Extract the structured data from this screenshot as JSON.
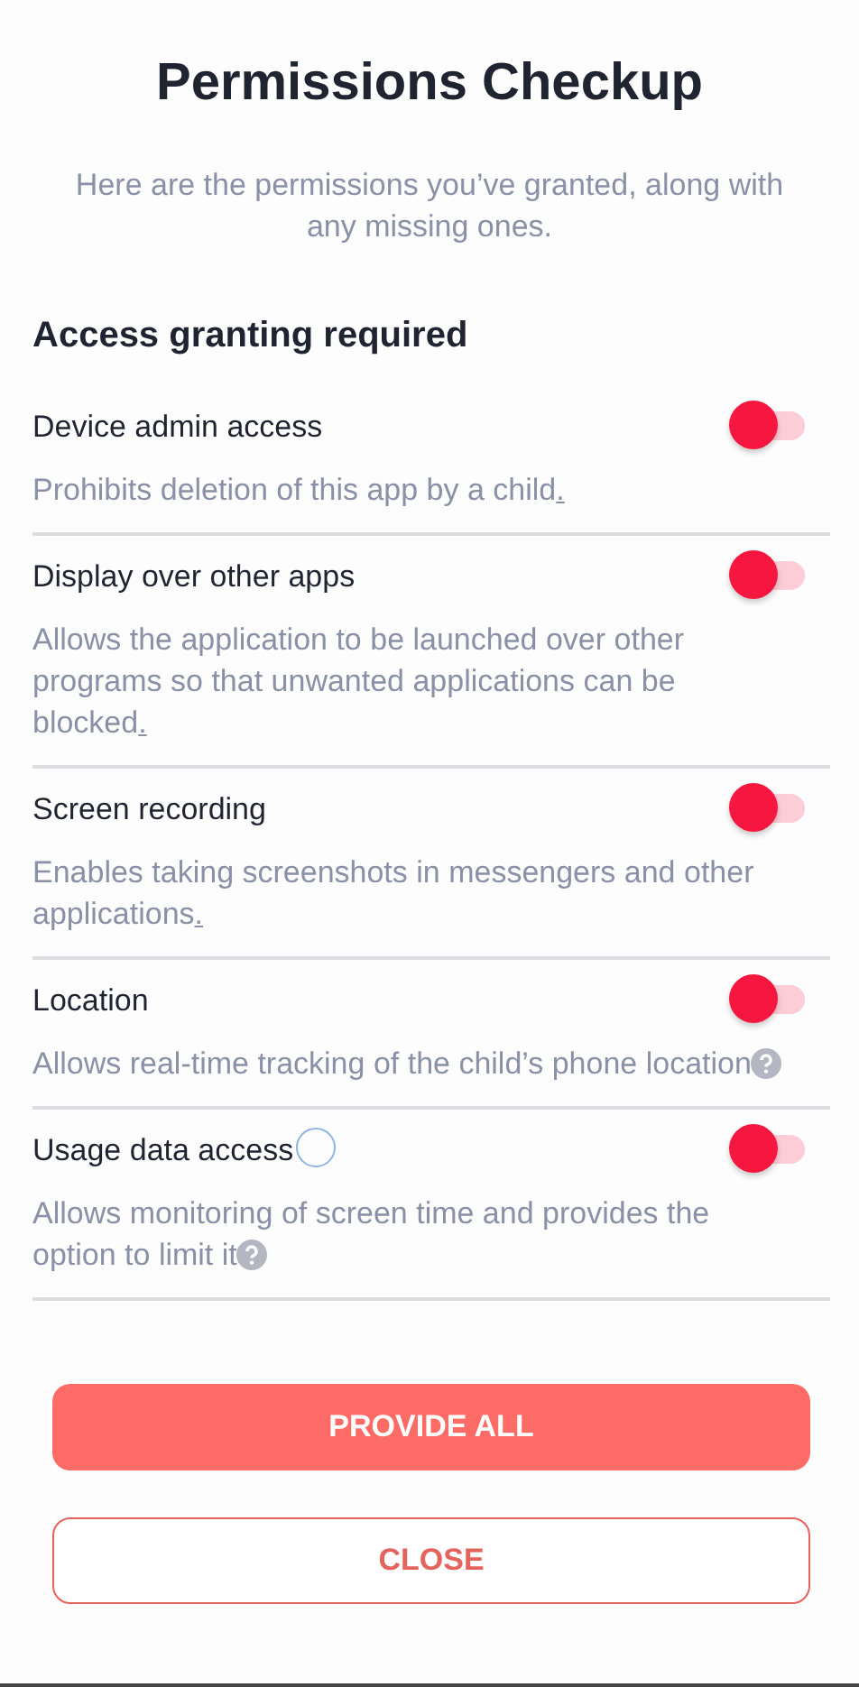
{
  "title": "Permissions Checkup",
  "subtitle": "Here are the permissions you’ve granted, along with any missing ones.",
  "section_title": "Access granting required",
  "permissions": [
    {
      "name": "Device admin access",
      "on": false,
      "description": "Prohibits deletion of this app by a child",
      "end": {
        "kind": "link",
        "text": "."
      }
    },
    {
      "name": "Display over other apps",
      "on": false,
      "description": "Allows the application to be launched over other programs so that unwanted applications can be blocked",
      "end": {
        "kind": "link",
        "text": "."
      }
    },
    {
      "name": "Screen recording",
      "on": false,
      "description": "Enables taking screenshots in messengers and other applications",
      "end": {
        "kind": "link",
        "text": "."
      }
    },
    {
      "name": "Location",
      "on": false,
      "description": "Allows real-time tracking of the child’s phone location",
      "end": {
        "kind": "help"
      }
    },
    {
      "name": "Usage data access",
      "on": false,
      "description": "Allows monitoring of screen time and provides the option to limit it",
      "end": {
        "kind": "help"
      }
    }
  ],
  "buttons": [
    {
      "label": "PROVIDE ALL",
      "kind": "primary"
    },
    {
      "label": "CLOSE",
      "kind": "outline"
    }
  ]
}
